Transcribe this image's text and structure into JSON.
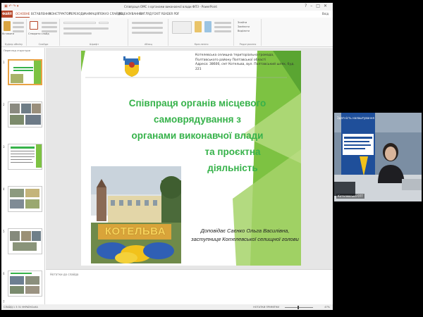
{
  "window": {
    "title": "Співпраця ОМС з органами виконавчої влади ФПЗ - PowerPoint",
    "controls": [
      "?",
      "–",
      "□",
      "✕"
    ]
  },
  "ribbon_tabs": {
    "file": "ФАЙЛ",
    "tabs": [
      "ОСНОВНЕ",
      "ВСТАВЛЕННЯ",
      "КОНСТРУКТОР",
      "ПЕРЕХОДИ",
      "АНІМАЦІЯ",
      "ПОКАЗ СЛАЙДІВ",
      "РЕЦЕНЗУВАННЯ",
      "ВИГЛЯД",
      "FOXIT READER PDF"
    ],
    "active": "ОСНОВНЕ",
    "signin": "Вхід"
  },
  "ribbon_groups": [
    "Буфер обміну",
    "Слайди",
    "Шрифт",
    "Абзац",
    "Креслення",
    "Редагування"
  ],
  "ribbon_text": {
    "paste": "Вставити",
    "new_slide": "Створити слайд",
    "find": "Знайти",
    "replace": "Замінити",
    "select": "Виділити"
  },
  "thumbnails": {
    "header": "Перегляд структури",
    "slides": [
      1,
      2,
      3,
      4,
      5,
      6,
      7
    ],
    "selected": 1
  },
  "slide": {
    "info_lines": [
      "Котелевська селищна територіальна громада,",
      "Полтавського району Полтавської області",
      "Адреса: 38600, смт Котельва, вул. Полтавський шлях, буд. 221"
    ],
    "title_lines": [
      "Співпраця органів місцевого",
      "самоврядування з",
      "органами виконавчої влади",
      "та проєктна діяльність"
    ],
    "presenter_lines": [
      "Доповідає Саєнко Ольга Василівна,",
      "заступниця Котелевської селищної голови"
    ],
    "photo_sign": "КОТЕЛЬВА",
    "colors": {
      "title": "#36b24a",
      "accent": "#7dc242"
    }
  },
  "notes": {
    "placeholder": "Нотатки до слайда"
  },
  "statusbar": {
    "left": "СЛАЙД 1 З 31    УКРАЇНСЬКА",
    "right": "НОТАТКИ    ПРИМІТКИ",
    "zoom": "47%"
  },
  "video": {
    "label": "Здатність налаштування",
    "name": "Котелевська ОТГ"
  }
}
